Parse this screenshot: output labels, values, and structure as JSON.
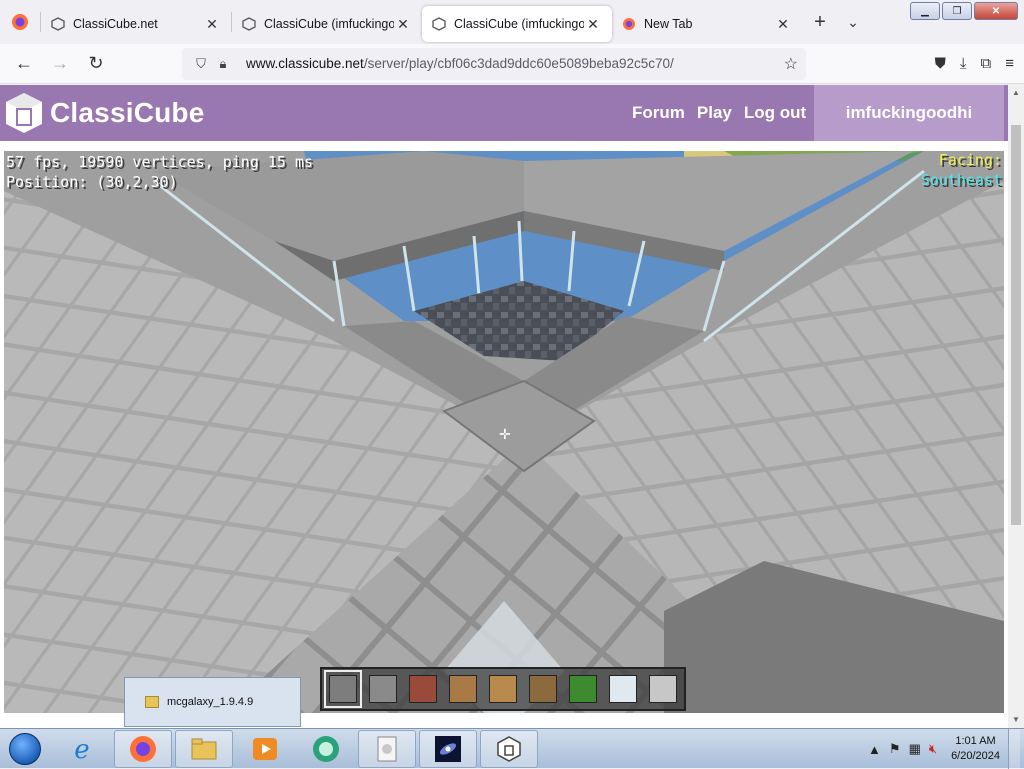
{
  "browser": {
    "tabs": [
      {
        "title": "ClassiCube.net",
        "active": false
      },
      {
        "title": "ClassiCube (imfuckingoo",
        "active": false
      },
      {
        "title": "ClassiCube (imfuckingoo",
        "active": true
      },
      {
        "title": "New Tab",
        "active": false
      }
    ],
    "url_domain": "www.classicube.net",
    "url_path": "/server/play/cbf06c3dad9ddc60e5089beba92c5c70/"
  },
  "site": {
    "name": "ClassiCube",
    "nav": [
      "Forum",
      "Play",
      "Log out"
    ],
    "username": "imfuckingoodhi"
  },
  "game": {
    "debug_line1": "57 fps, 19590 vertices, ping 15 ms",
    "debug_line2": "Position: (30,2,30)",
    "facing_label": "Facing:",
    "facing_value": "Southeast",
    "hotbar": [
      {
        "name": "stone",
        "color": "#7d7d7d"
      },
      {
        "name": "cobblestone",
        "color": "#8a8a8a"
      },
      {
        "name": "bricks",
        "color": "#9a4a3a"
      },
      {
        "name": "wood planks",
        "color": "#a87a45"
      },
      {
        "name": "wood planks",
        "color": "#b88a4d"
      },
      {
        "name": "log",
        "color": "#8b6a3e"
      },
      {
        "name": "leaves",
        "color": "#3e8a2e"
      },
      {
        "name": "glass",
        "color": "#dfe9ef"
      },
      {
        "name": "slab",
        "color": "#c7c7c7"
      }
    ],
    "selected_slot": 0
  },
  "taskbar": {
    "popup_label": "mcgalaxy_1.9.4.9",
    "time": "1:01 AM",
    "date": "6/20/2024"
  }
}
